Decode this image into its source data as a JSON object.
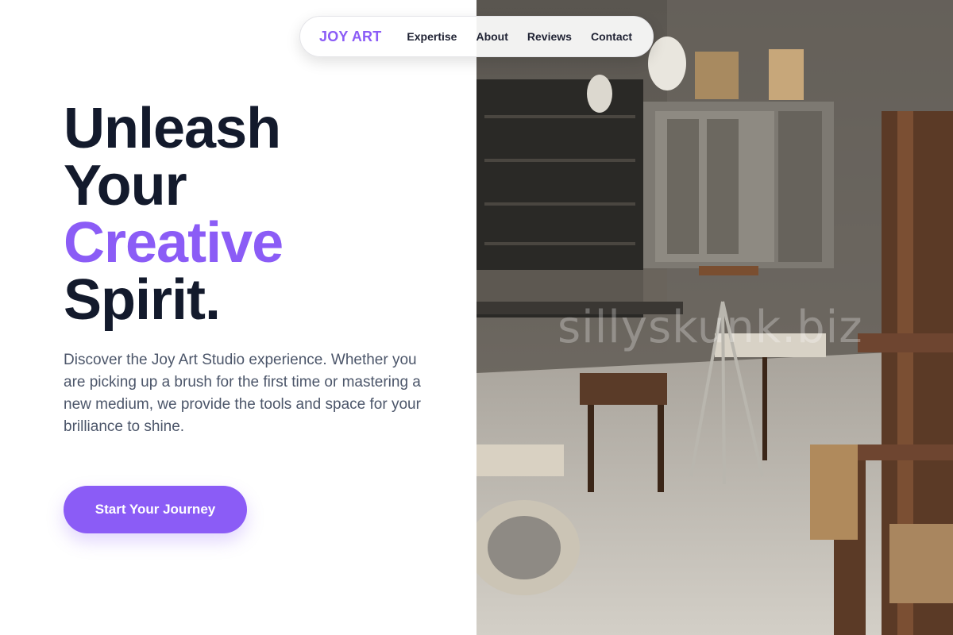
{
  "nav": {
    "brand": "JOY ART",
    "links": [
      "Expertise",
      "About",
      "Reviews",
      "Contact"
    ]
  },
  "hero": {
    "headline": [
      "Unleash",
      "Your",
      "Creative",
      "Spirit."
    ],
    "description": "Discover the Joy Art Studio experience. Whether you are picking up a brush for the first time or mastering a new medium, we provide the tools and space for your brilliance to shine.",
    "cta_label": "Start Your Journey"
  },
  "image": {
    "watermark": "sillyskunk.biz"
  },
  "colors": {
    "accent": "#8b5cf6",
    "heading": "#131a2c",
    "body_text": "#4c566a"
  }
}
